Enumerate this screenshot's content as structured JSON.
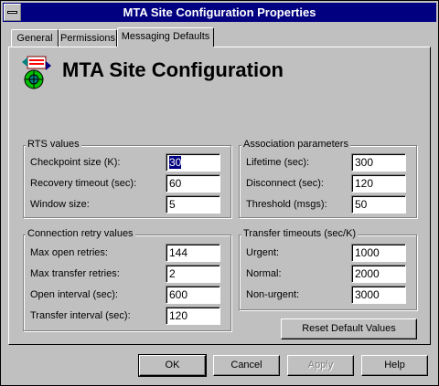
{
  "window": {
    "title": "MTA Site Configuration Properties"
  },
  "tabs": [
    {
      "label": "General"
    },
    {
      "label": "Permissions"
    },
    {
      "label": "Messaging Defaults"
    }
  ],
  "heading": {
    "title": "MTA Site Configuration",
    "icon": "mta-site-icon"
  },
  "rts": {
    "title": "RTS values",
    "fields": [
      {
        "label": "Checkpoint size (K):",
        "value": "30"
      },
      {
        "label": "Recovery timeout (sec):",
        "value": "60"
      },
      {
        "label": "Window size:",
        "value": "5"
      }
    ]
  },
  "association": {
    "title": "Association parameters",
    "fields": [
      {
        "label": "Lifetime (sec):",
        "value": "300"
      },
      {
        "label": "Disconnect (sec):",
        "value": "120"
      },
      {
        "label": "Threshold (msgs):",
        "value": "50"
      }
    ]
  },
  "retry": {
    "title": "Connection retry values",
    "fields": [
      {
        "label": "Max open retries:",
        "value": "144"
      },
      {
        "label": "Max transfer retries:",
        "value": "2"
      },
      {
        "label": "Open interval (sec):",
        "value": "600"
      },
      {
        "label": "Transfer interval (sec):",
        "value": "120"
      }
    ]
  },
  "timeouts": {
    "title": "Transfer timeouts (sec/K)",
    "fields": [
      {
        "label": "Urgent:",
        "value": "1000"
      },
      {
        "label": "Normal:",
        "value": "2000"
      },
      {
        "label": "Non-urgent:",
        "value": "3000"
      }
    ]
  },
  "buttons": {
    "reset": "Reset Default Values",
    "ok": "OK",
    "cancel": "Cancel",
    "apply": "Apply",
    "help": "Help"
  },
  "colors": {
    "title_bar": "#000080",
    "face": "#c0c0c0"
  }
}
